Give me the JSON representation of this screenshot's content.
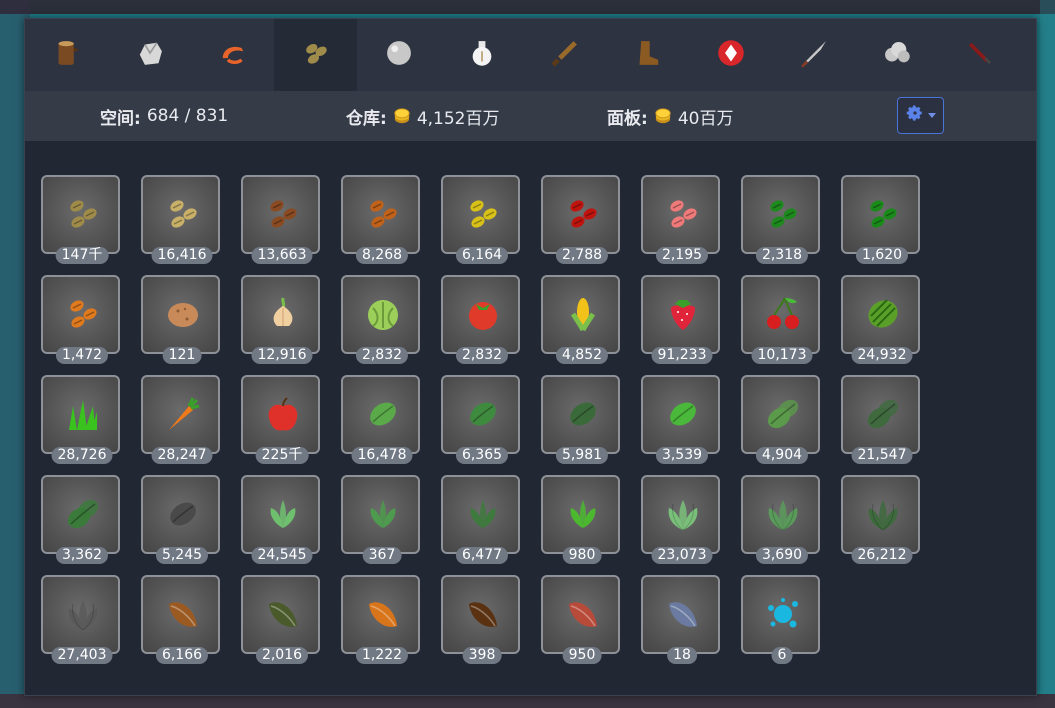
{
  "tabs": [
    {
      "icon": "log-icon"
    },
    {
      "icon": "ore-icon"
    },
    {
      "icon": "shrimp-icon"
    },
    {
      "icon": "seeds-icon"
    },
    {
      "icon": "gray-orb-icon"
    },
    {
      "icon": "potion-icon"
    },
    {
      "icon": "sword-icon"
    },
    {
      "icon": "boot-icon"
    },
    {
      "icon": "red-diamond-icon"
    },
    {
      "icon": "spear-icon"
    },
    {
      "icon": "cloud-icon"
    },
    {
      "icon": "dagger-icon"
    }
  ],
  "stats": {
    "space_label": "空间:",
    "space_value": "684 / 831",
    "bank_label": "仓库:",
    "bank_value": "4,152百万",
    "panel_label": "面板:",
    "panel_value": "40百万",
    "coin_icon": "gold-coin-icon",
    "settings_icon": "gear-icon"
  },
  "items": [
    {
      "qty": "147千",
      "icon": "seed-pair-icon",
      "color": "#a08c4a"
    },
    {
      "qty": "16,416",
      "icon": "seed-pair-icon",
      "color": "#c9b069"
    },
    {
      "qty": "13,663",
      "icon": "seed-pair-icon",
      "color": "#8a4a22"
    },
    {
      "qty": "8,268",
      "icon": "seed-pair-icon",
      "color": "#c0621a"
    },
    {
      "qty": "6,164",
      "icon": "seed-pair-icon",
      "color": "#d8c21a"
    },
    {
      "qty": "2,788",
      "icon": "seed-pair-icon",
      "color": "#c0140f"
    },
    {
      "qty": "2,195",
      "icon": "seed-pair-icon",
      "color": "#f07a7a"
    },
    {
      "qty": "2,318",
      "icon": "seed-pair-icon",
      "color": "#1e8a1e"
    },
    {
      "qty": "1,620",
      "icon": "seed-pair-icon",
      "color": "#1a8a1a"
    },
    {
      "qty": "1,472",
      "icon": "seed-pair-icon",
      "color": "#e07a1e"
    },
    {
      "qty": "121",
      "icon": "potato-icon",
      "color": "#c98a5a"
    },
    {
      "qty": "12,916",
      "icon": "onion-icon",
      "color": "#f0d0a0"
    },
    {
      "qty": "2,832",
      "icon": "cabbage-icon",
      "color": "#9ccf5a"
    },
    {
      "qty": "2,832",
      "icon": "tomato-icon",
      "color": "#e03a2a"
    },
    {
      "qty": "4,852",
      "icon": "corn-icon",
      "color": "#f2c21a"
    },
    {
      "qty": "91,233",
      "icon": "strawberry-icon",
      "color": "#e0243a"
    },
    {
      "qty": "10,173",
      "icon": "cherry-icon",
      "color": "#d81e1e"
    },
    {
      "qty": "24,932",
      "icon": "watermelon-icon",
      "color": "#5aa028"
    },
    {
      "qty": "28,726",
      "icon": "grass-icon",
      "color": "#3ac21e"
    },
    {
      "qty": "28,247",
      "icon": "carrot-icon",
      "color": "#f07a1a"
    },
    {
      "qty": "225千",
      "icon": "apple-icon",
      "color": "#e0302a"
    },
    {
      "qty": "16,478",
      "icon": "leaf-seed-icon",
      "color": "#5aaa4a"
    },
    {
      "qty": "6,365",
      "icon": "leaf-seed-icon",
      "color": "#3e8a3e"
    },
    {
      "qty": "5,981",
      "icon": "leaf-seed-icon",
      "color": "#3a6a3a"
    },
    {
      "qty": "3,539",
      "icon": "leaf-seed-icon",
      "color": "#4ab83a"
    },
    {
      "qty": "4,904",
      "icon": "double-leaf-seed-icon",
      "color": "#5a9a4a"
    },
    {
      "qty": "21,547",
      "icon": "double-leaf-seed-icon",
      "color": "#3e6a3e"
    },
    {
      "qty": "3,362",
      "icon": "double-leaf-seed-icon",
      "color": "#3a7a3a"
    },
    {
      "qty": "5,245",
      "icon": "leaf-seed-icon",
      "color": "#4a4a4a"
    },
    {
      "qty": "24,545",
      "icon": "herb-icon",
      "color": "#6ec06e"
    },
    {
      "qty": "367",
      "icon": "herb-icon",
      "color": "#4e9a4e"
    },
    {
      "qty": "6,477",
      "icon": "herb-icon",
      "color": "#3e7a3e"
    },
    {
      "qty": "980",
      "icon": "herb-icon",
      "color": "#4cb830"
    },
    {
      "qty": "23,073",
      "icon": "bushy-herb-icon",
      "color": "#7ac07a"
    },
    {
      "qty": "3,690",
      "icon": "bushy-herb-icon",
      "color": "#5a9a5a"
    },
    {
      "qty": "26,212",
      "icon": "bushy-herb-icon",
      "color": "#3e6a3e"
    },
    {
      "qty": "27,403",
      "icon": "bushy-herb-icon",
      "color": "#5a5a5a"
    },
    {
      "qty": "6,166",
      "icon": "pod-icon",
      "color": "#9a5a22"
    },
    {
      "qty": "2,016",
      "icon": "pod-icon",
      "color": "#4a5a2a"
    },
    {
      "qty": "1,222",
      "icon": "pod-icon",
      "color": "#d8741a"
    },
    {
      "qty": "398",
      "icon": "pod-icon",
      "color": "#5a3212"
    },
    {
      "qty": "950",
      "icon": "pod-icon",
      "color": "#b84a3a"
    },
    {
      "qty": "18",
      "icon": "pod-icon",
      "color": "#6a7aa0"
    },
    {
      "qty": "6",
      "icon": "splash-icon",
      "color": "#1ab8e0"
    }
  ]
}
